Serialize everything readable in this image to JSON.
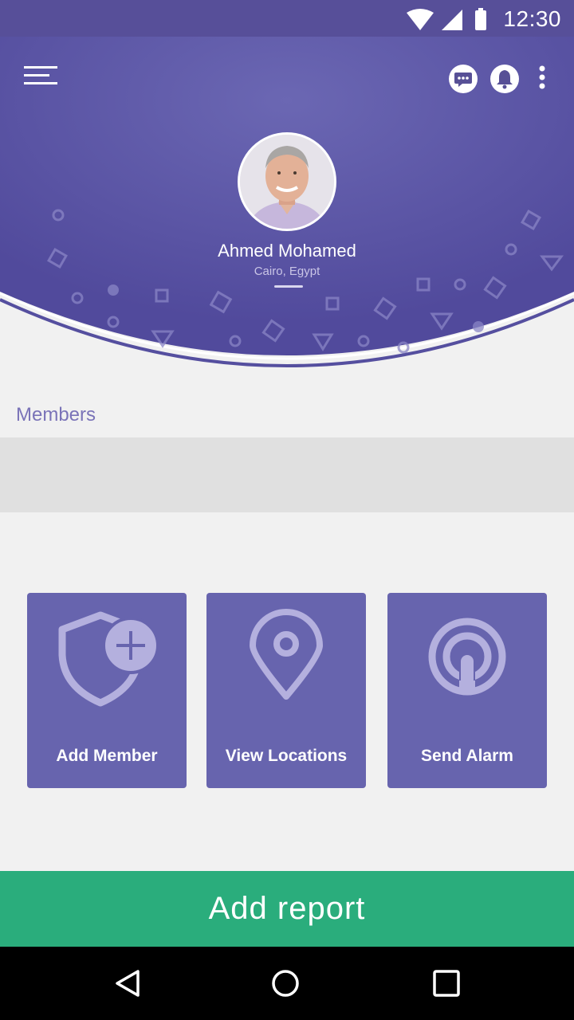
{
  "status_bar": {
    "time": "12:30"
  },
  "header": {
    "profile": {
      "name": "Ahmed Mohamed",
      "location": "Cairo, Egypt"
    }
  },
  "members": {
    "title": "Members"
  },
  "actions": [
    {
      "label": "Add Member",
      "icon": "shield-add-icon"
    },
    {
      "label": "View Locations",
      "icon": "location-pin-icon"
    },
    {
      "label": "Send Alarm",
      "icon": "alarm-signal-icon"
    }
  ],
  "footer": {
    "add_report_label": "Add report"
  },
  "colors": {
    "header": "#5a53a3",
    "status_bar": "#574f99",
    "card": "#6764ae",
    "add_report": "#2aad7c",
    "background": "#f1f1f1"
  }
}
